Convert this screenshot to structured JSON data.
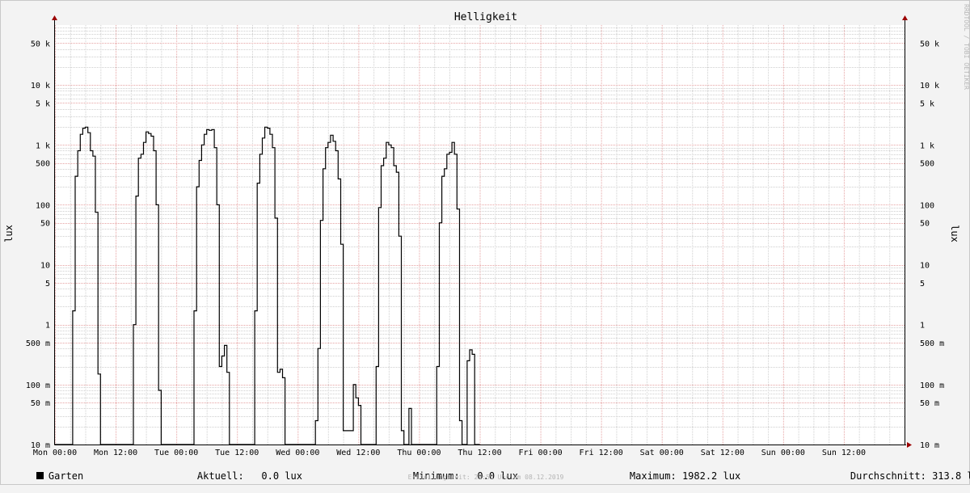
{
  "chart_data": {
    "type": "line",
    "title": "Helligkeit",
    "ylabel": "lux",
    "y_scale": "log",
    "ylim": [
      0.01,
      100000
    ],
    "xlim": [
      0,
      168
    ],
    "y_ticks": [
      {
        "value": 0.01,
        "label": "10 m"
      },
      {
        "value": 0.05,
        "label": "50 m"
      },
      {
        "value": 0.1,
        "label": "100 m"
      },
      {
        "value": 0.5,
        "label": "500 m"
      },
      {
        "value": 1,
        "label": "1"
      },
      {
        "value": 5,
        "label": "5"
      },
      {
        "value": 10,
        "label": "10"
      },
      {
        "value": 50,
        "label": "50"
      },
      {
        "value": 100,
        "label": "100"
      },
      {
        "value": 500,
        "label": "500"
      },
      {
        "value": 1000,
        "label": "1 k"
      },
      {
        "value": 5000,
        "label": "5 k"
      },
      {
        "value": 10000,
        "label": "10 k"
      },
      {
        "value": 50000,
        "label": "50 k"
      }
    ],
    "x_ticks": [
      {
        "value": 0,
        "label": "Mon 00:00"
      },
      {
        "value": 12,
        "label": "Mon 12:00"
      },
      {
        "value": 24,
        "label": "Tue 00:00"
      },
      {
        "value": 36,
        "label": "Tue 12:00"
      },
      {
        "value": 48,
        "label": "Wed 00:00"
      },
      {
        "value": 60,
        "label": "Wed 12:00"
      },
      {
        "value": 72,
        "label": "Thu 00:00"
      },
      {
        "value": 84,
        "label": "Thu 12:00"
      },
      {
        "value": 96,
        "label": "Fri 00:00"
      },
      {
        "value": 108,
        "label": "Fri 12:00"
      },
      {
        "value": 120,
        "label": "Sat 00:00"
      },
      {
        "value": 132,
        "label": "Sat 12:00"
      },
      {
        "value": 144,
        "label": "Sun 00:00"
      },
      {
        "value": 156,
        "label": "Sun 12:00"
      }
    ],
    "grid": true,
    "colors": {
      "background": "#ffffff",
      "grid_minor": "#cfcfcf",
      "grid_major": "#e6a3a3",
      "line": "#000000",
      "axis": "#000000",
      "arrow": "#9b0000"
    },
    "series": [
      {
        "name": "Garten",
        "color": "#000000",
        "points": [
          [
            0,
            0.01
          ],
          [
            3.5,
            0.01
          ],
          [
            3.5,
            1.7
          ],
          [
            4,
            1.7
          ],
          [
            4,
            300
          ],
          [
            4.5,
            300
          ],
          [
            4.5,
            800
          ],
          [
            5,
            800
          ],
          [
            5,
            1500
          ],
          [
            5.5,
            1500
          ],
          [
            5.5,
            1900
          ],
          [
            6,
            1900
          ],
          [
            6,
            1980
          ],
          [
            6.5,
            1980
          ],
          [
            6.5,
            1600
          ],
          [
            7,
            1600
          ],
          [
            7,
            800
          ],
          [
            7.5,
            800
          ],
          [
            7.5,
            650
          ],
          [
            8,
            650
          ],
          [
            8,
            75
          ],
          [
            8.5,
            75
          ],
          [
            8.5,
            0.15
          ],
          [
            9,
            0.15
          ],
          [
            9,
            0.01
          ],
          [
            15.5,
            0.01
          ],
          [
            15.5,
            1.0
          ],
          [
            16,
            1.0
          ],
          [
            16,
            140
          ],
          [
            16.5,
            140
          ],
          [
            16.5,
            600
          ],
          [
            17,
            600
          ],
          [
            17,
            700
          ],
          [
            17.5,
            700
          ],
          [
            17.5,
            1100
          ],
          [
            18,
            1100
          ],
          [
            18,
            1650
          ],
          [
            18.5,
            1650
          ],
          [
            18.5,
            1550
          ],
          [
            19,
            1550
          ],
          [
            19,
            1400
          ],
          [
            19.5,
            1400
          ],
          [
            19.5,
            800
          ],
          [
            20,
            800
          ],
          [
            20,
            100
          ],
          [
            20.5,
            100
          ],
          [
            20.5,
            0.08
          ],
          [
            21,
            0.08
          ],
          [
            21,
            0.01
          ],
          [
            27.5,
            0.01
          ],
          [
            27.5,
            1.7
          ],
          [
            28,
            1.7
          ],
          [
            28,
            200
          ],
          [
            28.5,
            200
          ],
          [
            28.5,
            550
          ],
          [
            29,
            550
          ],
          [
            29,
            1000
          ],
          [
            29.5,
            1000
          ],
          [
            29.5,
            1500
          ],
          [
            30,
            1500
          ],
          [
            30,
            1800
          ],
          [
            30.5,
            1800
          ],
          [
            30.5,
            1750
          ],
          [
            31,
            1750
          ],
          [
            31,
            1800
          ],
          [
            31.5,
            1800
          ],
          [
            31.5,
            900
          ],
          [
            32,
            900
          ],
          [
            32,
            100
          ],
          [
            32.5,
            100
          ],
          [
            32.5,
            0.2
          ],
          [
            33,
            0.2
          ],
          [
            33,
            0.3
          ],
          [
            33.5,
            0.3
          ],
          [
            33.5,
            0.45
          ],
          [
            34,
            0.45
          ],
          [
            34,
            0.16
          ],
          [
            34.5,
            0.16
          ],
          [
            34.5,
            0.01
          ],
          [
            39.5,
            0.01
          ],
          [
            39.5,
            1.7
          ],
          [
            40,
            1.7
          ],
          [
            40,
            230
          ],
          [
            40.5,
            230
          ],
          [
            40.5,
            700
          ],
          [
            41,
            700
          ],
          [
            41,
            1300
          ],
          [
            41.5,
            1300
          ],
          [
            41.5,
            1980
          ],
          [
            42,
            1980
          ],
          [
            42,
            1900
          ],
          [
            42.5,
            1900
          ],
          [
            42.5,
            1500
          ],
          [
            43,
            1500
          ],
          [
            43,
            900
          ],
          [
            43.5,
            900
          ],
          [
            43.5,
            60
          ],
          [
            44,
            60
          ],
          [
            44,
            0.16
          ],
          [
            44.5,
            0.16
          ],
          [
            44.5,
            0.18
          ],
          [
            45,
            0.18
          ],
          [
            45,
            0.13
          ],
          [
            45.5,
            0.13
          ],
          [
            45.5,
            0.01
          ],
          [
            51.5,
            0.01
          ],
          [
            51.5,
            0.025
          ],
          [
            52,
            0.025
          ],
          [
            52,
            0.4
          ],
          [
            52.5,
            0.4
          ],
          [
            52.5,
            55
          ],
          [
            53,
            55
          ],
          [
            53,
            400
          ],
          [
            53.5,
            400
          ],
          [
            53.5,
            900
          ],
          [
            54,
            900
          ],
          [
            54,
            1100
          ],
          [
            54.5,
            1100
          ],
          [
            54.5,
            1450
          ],
          [
            55,
            1450
          ],
          [
            55,
            1150
          ],
          [
            55.5,
            1150
          ],
          [
            55.5,
            800
          ],
          [
            56,
            800
          ],
          [
            56,
            270
          ],
          [
            56.5,
            270
          ],
          [
            56.5,
            22
          ],
          [
            57,
            22
          ],
          [
            57,
            0.017
          ],
          [
            58,
            0.017
          ],
          [
            58,
            0.017
          ],
          [
            59,
            0.017
          ],
          [
            59,
            0.1
          ],
          [
            59.5,
            0.1
          ],
          [
            59.5,
            0.06
          ],
          [
            60,
            0.06
          ],
          [
            60,
            0.045
          ],
          [
            60.5,
            0.045
          ],
          [
            60.5,
            0.01
          ],
          [
            63.5,
            0.01
          ],
          [
            63.5,
            0.2
          ],
          [
            64,
            0.2
          ],
          [
            64,
            90
          ],
          [
            64.5,
            90
          ],
          [
            64.5,
            450
          ],
          [
            65,
            450
          ],
          [
            65,
            600
          ],
          [
            65.5,
            600
          ],
          [
            65.5,
            1100
          ],
          [
            66,
            1100
          ],
          [
            66,
            1000
          ],
          [
            66.5,
            1000
          ],
          [
            66.5,
            900
          ],
          [
            67,
            900
          ],
          [
            67,
            450
          ],
          [
            67.5,
            450
          ],
          [
            67.5,
            350
          ],
          [
            68,
            350
          ],
          [
            68,
            30
          ],
          [
            68.5,
            30
          ],
          [
            68.5,
            0.017
          ],
          [
            69,
            0.017
          ],
          [
            69,
            0.01
          ],
          [
            70,
            0.01
          ],
          [
            70,
            0.04
          ],
          [
            70.5,
            0.04
          ],
          [
            70.5,
            0.01
          ],
          [
            75.5,
            0.01
          ],
          [
            75.5,
            0.2
          ],
          [
            76,
            0.2
          ],
          [
            76,
            50
          ],
          [
            76.5,
            50
          ],
          [
            76.5,
            300
          ],
          [
            77,
            300
          ],
          [
            77,
            400
          ],
          [
            77.5,
            400
          ],
          [
            77.5,
            700
          ],
          [
            78,
            700
          ],
          [
            78,
            750
          ],
          [
            78.5,
            750
          ],
          [
            78.5,
            1100
          ],
          [
            79,
            1100
          ],
          [
            79,
            700
          ],
          [
            79.5,
            700
          ],
          [
            79.5,
            85
          ],
          [
            80,
            85
          ],
          [
            80,
            0.025
          ],
          [
            80.5,
            0.025
          ],
          [
            80.5,
            0.01
          ],
          [
            81.5,
            0.01
          ],
          [
            81.5,
            0.25
          ],
          [
            82,
            0.25
          ],
          [
            82,
            0.38
          ],
          [
            82.5,
            0.38
          ],
          [
            82.5,
            0.32
          ],
          [
            83,
            0.32
          ],
          [
            83,
            0.01
          ],
          [
            84,
            0.01
          ]
        ]
      }
    ],
    "legend": {
      "series_name": "Garten",
      "current_label": "Aktuell:",
      "current_value": "0.0 lux",
      "min_label": "Minimum:",
      "min_value": "0.0 lux",
      "max_label": "Maximum:",
      "max_value": "1982.2 lux",
      "avg_label": "Durchschnitt:",
      "avg_value": "313.8 lux"
    },
    "footer": "Erstellungszeit: 23:55 Uhr am 08.12.2019",
    "credit": "RRDTOOL / TOBI OETIKER"
  }
}
